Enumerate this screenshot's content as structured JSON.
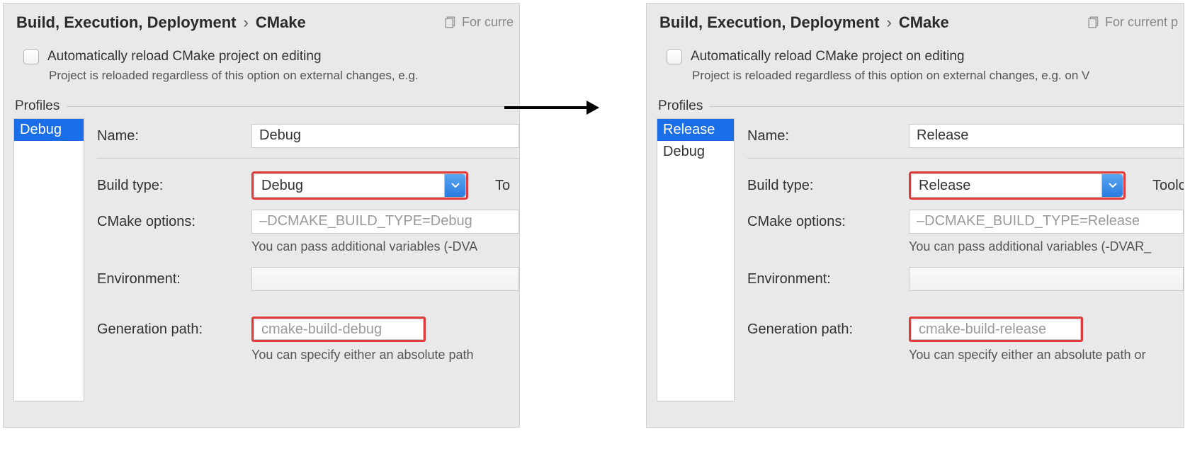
{
  "breadcrumb": {
    "parent": "Build, Execution, Deployment",
    "sep": "›",
    "child": "CMake"
  },
  "scope_hint": {
    "left": "For curre",
    "right": "For current p"
  },
  "auto_reload": {
    "label": "Automatically reload CMake project on editing",
    "hint_left": "Project is reloaded regardless of this option on external changes, e.g.",
    "hint_right": "Project is reloaded regardless of this option on external changes, e.g. on V"
  },
  "profiles_label": "Profiles",
  "left": {
    "profiles": [
      "Debug"
    ],
    "selected": "Debug",
    "name_label": "Name:",
    "name_value": "Debug",
    "build_type_label": "Build type:",
    "build_type_value": "Debug",
    "after_select": "To",
    "cmake_options_label": "CMake options:",
    "cmake_options_placeholder": "–DCMAKE_BUILD_TYPE=Debug",
    "cmake_options_hint": "You can pass additional variables (-DVA",
    "env_label": "Environment:",
    "gen_label": "Generation path:",
    "gen_value": "cmake-build-debug",
    "gen_hint": "You can specify either an absolute path"
  },
  "right": {
    "profiles": [
      "Release",
      "Debug"
    ],
    "selected": "Release",
    "name_label": "Name:",
    "name_value": "Release",
    "build_type_label": "Build type:",
    "build_type_value": "Release",
    "after_select": "Toolc",
    "cmake_options_label": "CMake options:",
    "cmake_options_placeholder": "–DCMAKE_BUILD_TYPE=Release",
    "cmake_options_hint": "You can pass additional variables (-DVAR_",
    "env_label": "Environment:",
    "gen_label": "Generation path:",
    "gen_value": "cmake-build-release",
    "gen_hint": "You can specify either an absolute path or"
  }
}
